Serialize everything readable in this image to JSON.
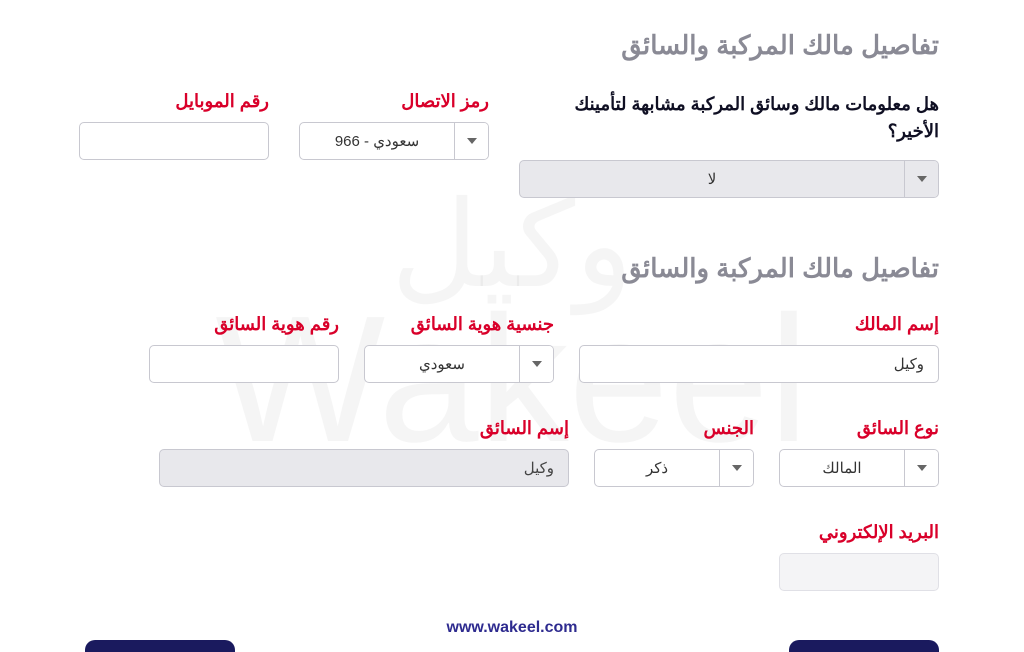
{
  "watermark_ar": "وكيل",
  "watermark_en": "Wakeel",
  "section1_title": "تفاصيل مالك المركبة والسائق",
  "question": "هل معلومات مالك وسائق المركبة مشابهة لتأمينك الأخير؟",
  "answer_no": "لا",
  "dial_code_label": "رمز الاتصال",
  "dial_code_value": "سعودي - 966",
  "mobile_label": "رقم الموبايل",
  "section2_title": "تفاصيل مالك المركبة والسائق",
  "owner_name_label": "إسم المالك",
  "owner_name_value": "وكيل",
  "driver_nat_label": "جنسية هوية السائق",
  "driver_nat_value": "سعودي",
  "driver_id_label": "رقم هوية السائق",
  "driver_type_label": "نوع السائق",
  "driver_type_value": "المالك",
  "gender_label": "الجنس",
  "gender_value": "ذكر",
  "driver_name_label": "إسم السائق",
  "driver_name_value": "وكيل",
  "email_label": "البريد الإلكتروني",
  "footer_url": "www.wakeel.com"
}
